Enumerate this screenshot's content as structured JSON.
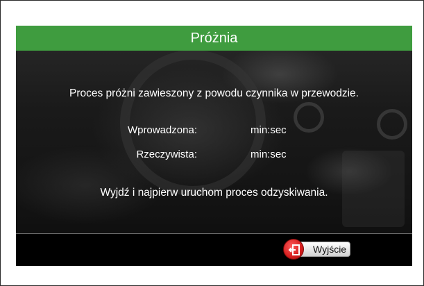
{
  "screen": {
    "title": "Próżnia",
    "message": "Proces próżni zawieszony z powodu czynnika w przewodzie.",
    "rows": [
      {
        "label": "Wprowadzona:",
        "value": "min:sec"
      },
      {
        "label": "Rzeczywista:",
        "value": "min:sec"
      }
    ],
    "instruction": "Wyjdź i najpierw uruchom proces odzyskiwania."
  },
  "footer": {
    "exit_label": "Wyjście",
    "exit_icon": "exit-door-icon"
  },
  "colors": {
    "titlebar": "#3f9c3f",
    "exit_icon": "#d41e1e"
  }
}
